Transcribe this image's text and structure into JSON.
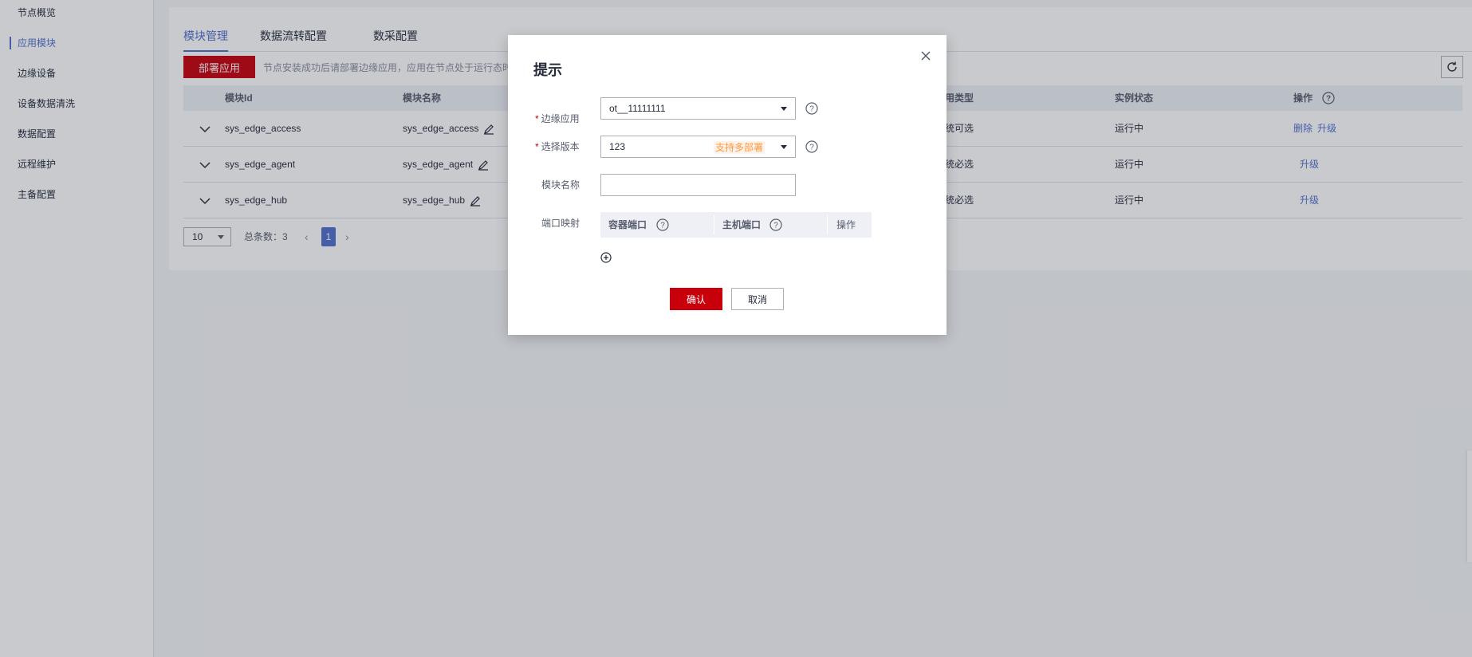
{
  "sidebar": {
    "items": [
      {
        "label": "节点概览"
      },
      {
        "label": "应用模块"
      },
      {
        "label": "边缘设备"
      },
      {
        "label": "设备数据清洗"
      },
      {
        "label": "数据配置"
      },
      {
        "label": "远程维护"
      },
      {
        "label": "主备配置"
      }
    ],
    "active_index": 1
  },
  "tabs": [
    {
      "label": "模块管理"
    },
    {
      "label": "数据流转配置"
    },
    {
      "label": "数采配置"
    }
  ],
  "toolbar": {
    "deploy_label": "部署应用",
    "hint": "节点安装成功后请部署边缘应用，应用在节点处于运行态时"
  },
  "table": {
    "headers": {
      "module_id": "模块Id",
      "module_name": "模块名称",
      "app_type": "用类型",
      "instance_status": "实例状态",
      "actions": "操作"
    },
    "rows": [
      {
        "module_id": "sys_edge_access",
        "module_name": "sys_edge_access",
        "app_type": "统可选",
        "status": "运行中",
        "action_delete": "删除",
        "action_upgrade": "升级"
      },
      {
        "module_id": "sys_edge_agent",
        "module_name": "sys_edge_agent",
        "app_type": "统必选",
        "status": "运行中",
        "action_delete": "",
        "action_upgrade": "升级"
      },
      {
        "module_id": "sys_edge_hub",
        "module_name": "sys_edge_hub",
        "app_type": "统必选",
        "status": "运行中",
        "action_delete": "",
        "action_upgrade": "升级"
      }
    ]
  },
  "pager": {
    "page_size": "10",
    "total_label": "总条数：3",
    "current_page": "1"
  },
  "dialog": {
    "title": "提示",
    "fields": {
      "edge_app": {
        "label": "边缘应用",
        "value": "ot__11111111"
      },
      "version": {
        "label": "选择版本",
        "value": "123",
        "tag": "支持多部署"
      },
      "module_name": {
        "label": "模块名称",
        "value": ""
      },
      "port_mapping": {
        "label": "端口映射"
      }
    },
    "port_table": {
      "container_port": "容器端口",
      "host_port": "主机端口",
      "actions": "操作"
    },
    "confirm_label": "确认",
    "cancel_label": "取消"
  },
  "colors": {
    "primary_red": "#c7000b",
    "accent_blue": "#526ecc",
    "tag_orange": "#fa9841"
  }
}
